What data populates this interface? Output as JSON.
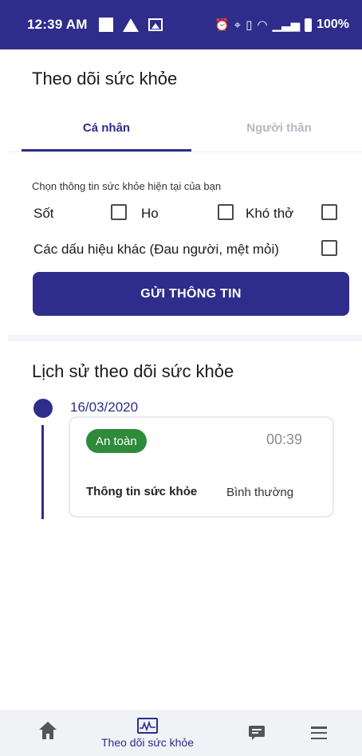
{
  "status_bar": {
    "time": "12:39 AM",
    "battery_text": "100%",
    "icons": [
      "square-icon",
      "warning-icon",
      "image-icon",
      "alarm-icon",
      "location-icon",
      "vibrate-icon",
      "wifi-icon",
      "signal-icon",
      "battery-icon"
    ]
  },
  "header": {
    "title": "Theo dõi sức khỏe"
  },
  "tabs": [
    {
      "label": "Cá nhân",
      "active": true
    },
    {
      "label": "Người thân",
      "active": false
    }
  ],
  "form": {
    "prompt": "Chọn thông tin sức khỏe hiện tại của bạn",
    "symptoms": [
      {
        "label": "Sốt",
        "checked": false
      },
      {
        "label": "Ho",
        "checked": false
      },
      {
        "label": "Khó thở",
        "checked": false
      },
      {
        "label": "Các dấu hiệu khác (Đau người, mệt mỏi)",
        "checked": false
      }
    ],
    "submit_label": "GỬI THÔNG TIN"
  },
  "history": {
    "title": "Lịch sử theo dõi sức khỏe",
    "entries": [
      {
        "date": "16/03/2020",
        "status": "An toàn",
        "time": "00:39",
        "info_label": "Thông tin sức khỏe",
        "info_value": "Bình thường"
      }
    ]
  },
  "bottom_nav": {
    "items": [
      {
        "icon": "home-icon",
        "label": ""
      },
      {
        "icon": "health-chart-icon",
        "label": "Theo dõi sức khỏe"
      },
      {
        "icon": "chat-icon",
        "label": ""
      },
      {
        "icon": "menu-icon",
        "label": ""
      }
    ]
  },
  "colors": {
    "primary": "#2e2d8c",
    "safe_badge": "#2e8b3a",
    "inactive_tab": "#b5b8c4",
    "nav_background": "#f1f2f6"
  }
}
